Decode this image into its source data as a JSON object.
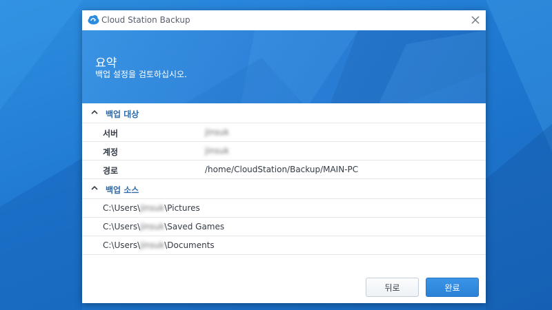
{
  "window": {
    "title": "Cloud Station Backup",
    "app_icon": "cloud-icon",
    "close_icon": "close-icon"
  },
  "banner": {
    "title": "요약",
    "subtitle": "백업 설정을 검토하십시오."
  },
  "sections": {
    "target": {
      "title": "백업 대상",
      "rows": [
        {
          "label": "서버",
          "value": "jinsuk"
        },
        {
          "label": "계정",
          "value": "jinsuk"
        },
        {
          "label": "경로",
          "value": "/home/CloudStation/Backup/MAIN-PC"
        }
      ]
    },
    "source": {
      "title": "백업 소스",
      "items": [
        {
          "prefix": "C:\\Users\\",
          "user": "jinsuk",
          "suffix": "\\Pictures"
        },
        {
          "prefix": "C:\\Users\\",
          "user": "jinsuk",
          "suffix": "\\Saved Games"
        },
        {
          "prefix": "C:\\Users\\",
          "user": "jinsuk",
          "suffix": "\\Documents"
        }
      ]
    }
  },
  "buttons": {
    "back": "뒤로",
    "finish": "완료"
  },
  "colors": {
    "accent": "#2a82d8",
    "section_title": "#2f6aa8",
    "desktop": "#1f78d0"
  }
}
